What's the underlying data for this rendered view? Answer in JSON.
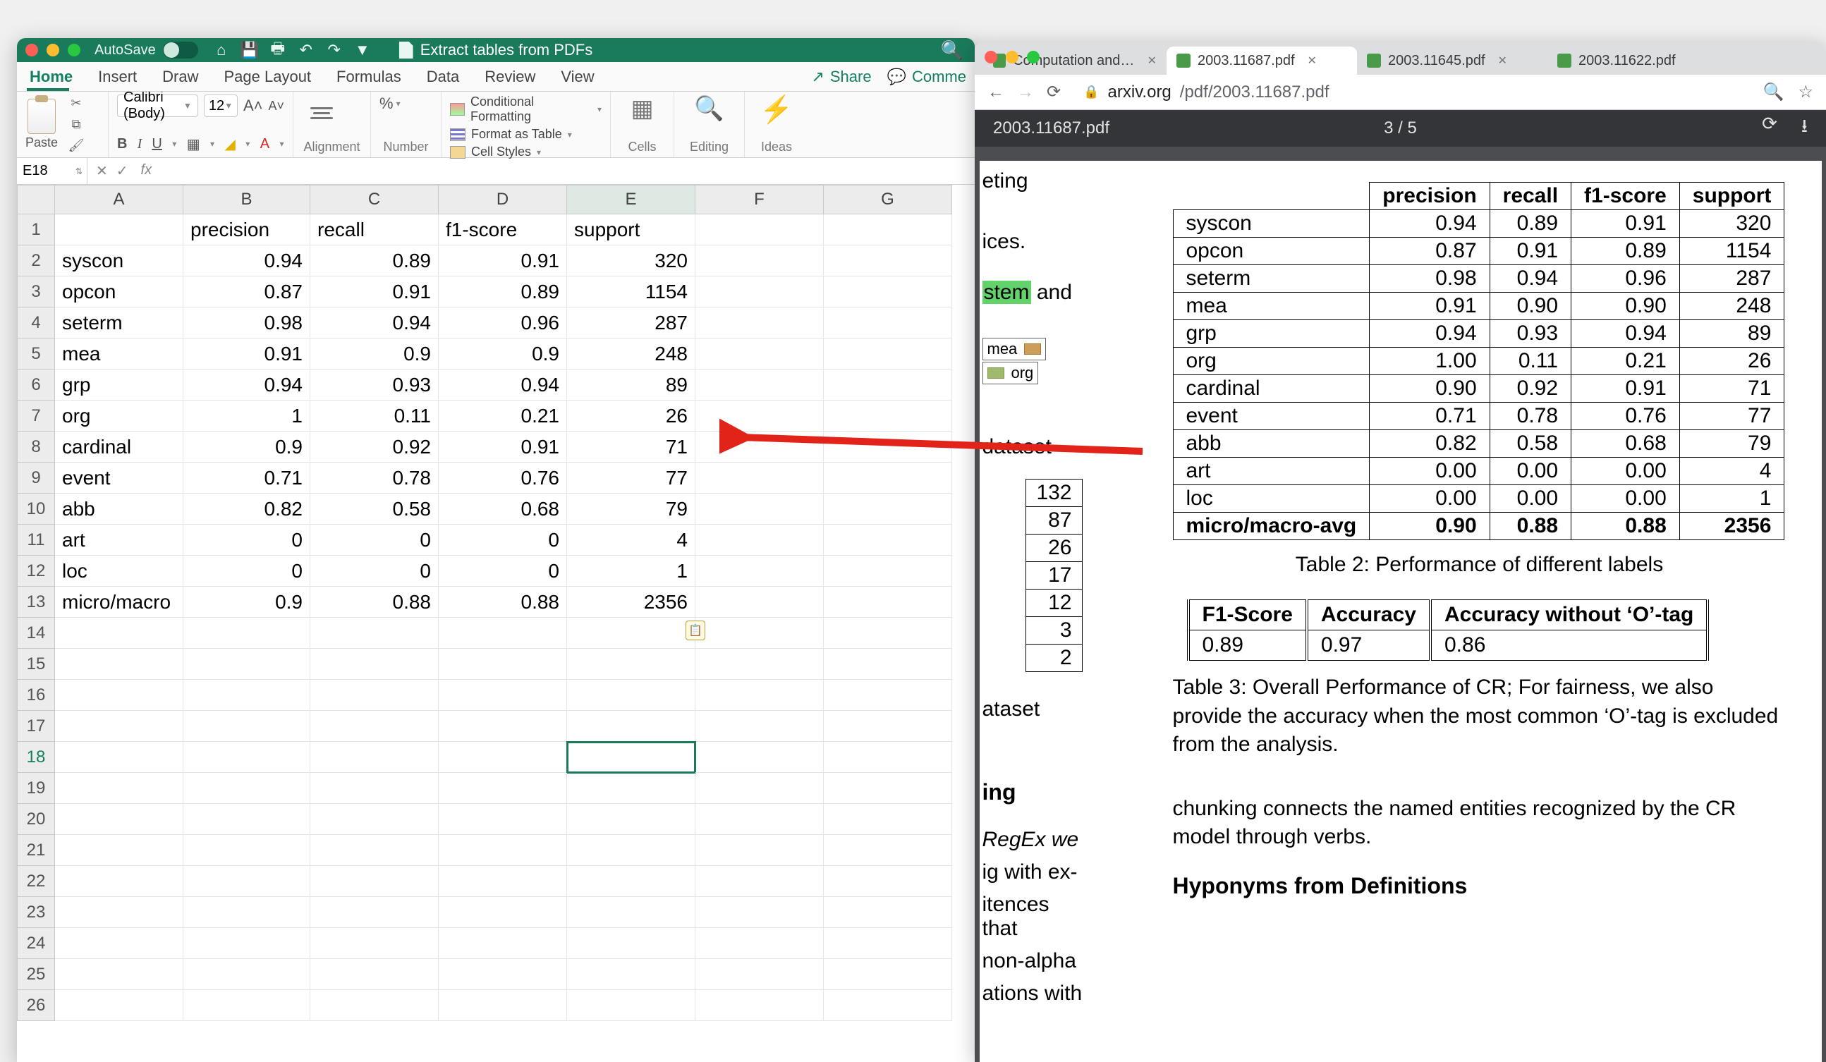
{
  "excel": {
    "autosave_label": "AutoSave",
    "doc_title": "Extract tables from PDFs",
    "tabs": [
      "Home",
      "Insert",
      "Draw",
      "Page Layout",
      "Formulas",
      "Data",
      "Review",
      "View"
    ],
    "active_tab": "Home",
    "share_label": "Share",
    "comments_label": "Comme",
    "paste_label": "Paste",
    "font_name": "Calibri (Body)",
    "font_size": "12",
    "group_labels": {
      "alignment": "Alignment",
      "number": "Number",
      "cells": "Cells",
      "editing": "Editing",
      "ideas": "Ideas"
    },
    "styles": {
      "cond": "Conditional Formatting",
      "table": "Format as Table",
      "cell": "Cell Styles"
    },
    "namebox": "E18",
    "columns": [
      "A",
      "B",
      "C",
      "D",
      "E",
      "F",
      "G"
    ],
    "rows_count": 26,
    "headers": [
      "precision",
      "recall",
      "f1-score",
      "support"
    ],
    "data_rows": [
      {
        "label": "syscon",
        "vals": [
          "0.94",
          "0.89",
          "0.91",
          "320"
        ]
      },
      {
        "label": "opcon",
        "vals": [
          "0.87",
          "0.91",
          "0.89",
          "1154"
        ]
      },
      {
        "label": "seterm",
        "vals": [
          "0.98",
          "0.94",
          "0.96",
          "287"
        ]
      },
      {
        "label": "mea",
        "vals": [
          "0.91",
          "0.9",
          "0.9",
          "248"
        ]
      },
      {
        "label": "grp",
        "vals": [
          "0.94",
          "0.93",
          "0.94",
          "89"
        ]
      },
      {
        "label": "org",
        "vals": [
          "1",
          "0.11",
          "0.21",
          "26"
        ]
      },
      {
        "label": "cardinal",
        "vals": [
          "0.9",
          "0.92",
          "0.91",
          "71"
        ]
      },
      {
        "label": "event",
        "vals": [
          "0.71",
          "0.78",
          "0.76",
          "77"
        ]
      },
      {
        "label": "abb",
        "vals": [
          "0.82",
          "0.58",
          "0.68",
          "79"
        ]
      },
      {
        "label": "art",
        "vals": [
          "0",
          "0",
          "0",
          "4"
        ]
      },
      {
        "label": "loc",
        "vals": [
          "0",
          "0",
          "0",
          "1"
        ]
      },
      {
        "label": "micro/macro",
        "vals": [
          "0.9",
          "0.88",
          "0.88",
          "2356"
        ]
      }
    ],
    "selected_cell_row": 18
  },
  "chrome": {
    "tabs": [
      {
        "label": "Computation and Lan",
        "active": false,
        "close": true
      },
      {
        "label": "2003.11687.pdf",
        "active": true,
        "close": true
      },
      {
        "label": "2003.11645.pdf",
        "active": false,
        "close": true
      },
      {
        "label": "2003.11622.pdf",
        "active": false,
        "close": false
      }
    ],
    "url_host": "arxiv.org",
    "url_path": "/pdf/2003.11687.pdf",
    "pdf_filename": "2003.11687.pdf",
    "page_indicator": "3 / 5",
    "table2": {
      "headers": [
        "precision",
        "recall",
        "f1-score",
        "support"
      ],
      "rows": [
        {
          "label": "syscon",
          "vals": [
            "0.94",
            "0.89",
            "0.91",
            "320"
          ]
        },
        {
          "label": "opcon",
          "vals": [
            "0.87",
            "0.91",
            "0.89",
            "1154"
          ]
        },
        {
          "label": "seterm",
          "vals": [
            "0.98",
            "0.94",
            "0.96",
            "287"
          ]
        },
        {
          "label": "mea",
          "vals": [
            "0.91",
            "0.90",
            "0.90",
            "248"
          ]
        },
        {
          "label": "grp",
          "vals": [
            "0.94",
            "0.93",
            "0.94",
            "89"
          ]
        },
        {
          "label": "org",
          "vals": [
            "1.00",
            "0.11",
            "0.21",
            "26"
          ]
        },
        {
          "label": "cardinal",
          "vals": [
            "0.90",
            "0.92",
            "0.91",
            "71"
          ]
        },
        {
          "label": "event",
          "vals": [
            "0.71",
            "0.78",
            "0.76",
            "77"
          ]
        },
        {
          "label": "abb",
          "vals": [
            "0.82",
            "0.58",
            "0.68",
            "79"
          ]
        },
        {
          "label": "art",
          "vals": [
            "0.00",
            "0.00",
            "0.00",
            "4"
          ]
        },
        {
          "label": "loc",
          "vals": [
            "0.00",
            "0.00",
            "0.00",
            "1"
          ]
        }
      ],
      "avg": {
        "label": "micro/macro-avg",
        "vals": [
          "0.90",
          "0.88",
          "0.88",
          "2356"
        ]
      },
      "caption": "Table 2: Performance of different labels"
    },
    "table3": {
      "headers": [
        "F1-Score",
        "Accuracy",
        "Accuracy without ‘O’-tag"
      ],
      "vals": [
        "0.89",
        "0.97",
        "0.86"
      ],
      "caption": "Table 3: Overall Performance of CR; For fairness, we also provide the accuracy when the most common ‘O’-tag is excluded from the analysis."
    },
    "body_text": "chunking connects the named entities recognized by the CR model through verbs.",
    "sub_header": "Hyponyms from Definitions",
    "left_frag": {
      "lines1": [
        "eting"
      ],
      "lines2": [
        "ices."
      ],
      "legend": [
        "mea",
        "org"
      ],
      "lines3": [
        "dataset"
      ],
      "nums": [
        "132",
        "87",
        "26",
        "17",
        "12",
        "3",
        "2"
      ],
      "lines4": [
        "ataset"
      ],
      "heading": "ing",
      "para": [
        "RegEx we",
        "ig with ex-",
        "itences that",
        " non-alpha",
        "ations with"
      ],
      "stem_text": "stem",
      "and_text": " and"
    }
  }
}
